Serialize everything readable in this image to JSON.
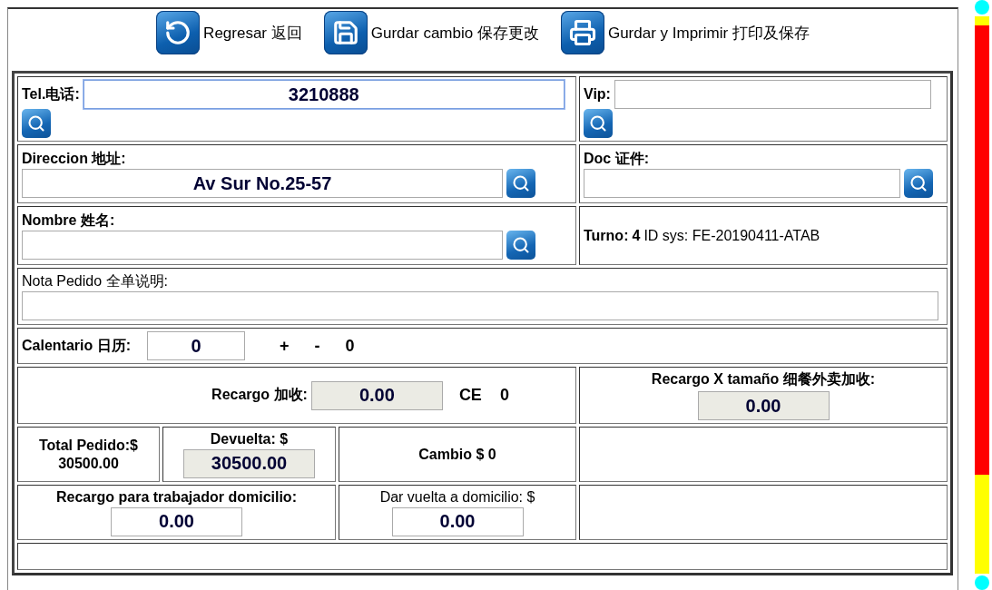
{
  "toolbar": [
    {
      "kind": "back",
      "label": "Regresar 返回"
    },
    {
      "kind": "save",
      "label": "Gurdar cambio 保存更改"
    },
    {
      "kind": "print",
      "label": "Gurdar y Imprimir 打印及保存"
    }
  ],
  "tel": {
    "label": "Tel.电话:",
    "value": "3210888",
    "focused": true
  },
  "vip": {
    "label": "Vip:"
  },
  "direccion": {
    "label": "Direccion 地址:",
    "value": "Av Sur No.25-57"
  },
  "doc": {
    "label": "Doc 证件:"
  },
  "nombre": {
    "label": "Nombre 姓名:"
  },
  "turno": {
    "label": "Turno:",
    "value": "4",
    "id_text": "ID sys: FE-20190411-ATAB"
  },
  "nota": {
    "label": "Nota Pedido 全单说明:"
  },
  "calendario": {
    "label": "Calentario 日历:",
    "value": "0",
    "readonly": false,
    "plus": "+",
    "minus": "-",
    "count": "0"
  },
  "recargo": {
    "label": "Recargo 加收:",
    "value": "0.00",
    "readonly": true,
    "ce_label": "CE",
    "ce_value": "0"
  },
  "recargo_tamano": {
    "label": "Recargo X tamaño 细餐外卖加收:",
    "value": "0.00",
    "readonly": true
  },
  "total": {
    "label": "Total Pedido:$",
    "value": "30500.00"
  },
  "devuelta": {
    "label": "Devuelta: $",
    "value": "30500.00",
    "readonly": true
  },
  "cambio": {
    "text": "Cambio $ 0"
  },
  "recargo_trabajador": {
    "label": "Recargo para trabajador domicilio:",
    "value": "0.00",
    "readonly": false
  },
  "dar_vuelta": {
    "label": "Dar vuelta a domicilio: $",
    "value": "0.00",
    "readonly": false
  }
}
